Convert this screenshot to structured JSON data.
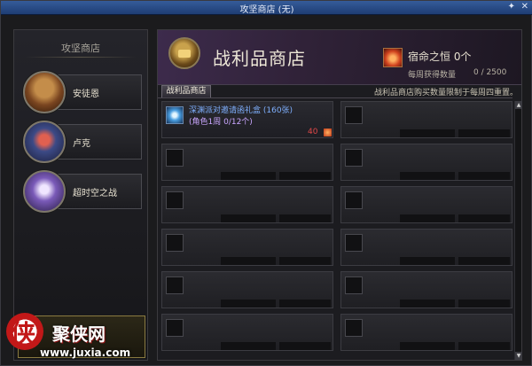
{
  "window": {
    "title": "攻坚商店 (无)",
    "pin_glyph": "✦",
    "close_glyph": "✕"
  },
  "sidebar": {
    "title": "攻坚商店",
    "items": [
      {
        "label": "安徒恩"
      },
      {
        "label": "卢克"
      },
      {
        "label": "超时空之战"
      }
    ]
  },
  "header": {
    "shop_title": "战利品商店",
    "currency_name": "宿命之恒",
    "currency_count": "0个",
    "weekly_label": "每周获得数量",
    "weekly_value": "0 / 2500"
  },
  "tabs": [
    {
      "label": "战利品商店"
    }
  ],
  "notice": "战利品商店购买数量限制于每周四重置。",
  "items": [
    {
      "name": "深渊派对邀请函礼盒 (160张)",
      "limit": "(角色1周 0/12个)",
      "price": "40"
    }
  ],
  "scrollbar": {
    "up": "▲",
    "down": "▼"
  },
  "watermark": {
    "brand": "聚侠网",
    "url": "www.juxia.com"
  }
}
